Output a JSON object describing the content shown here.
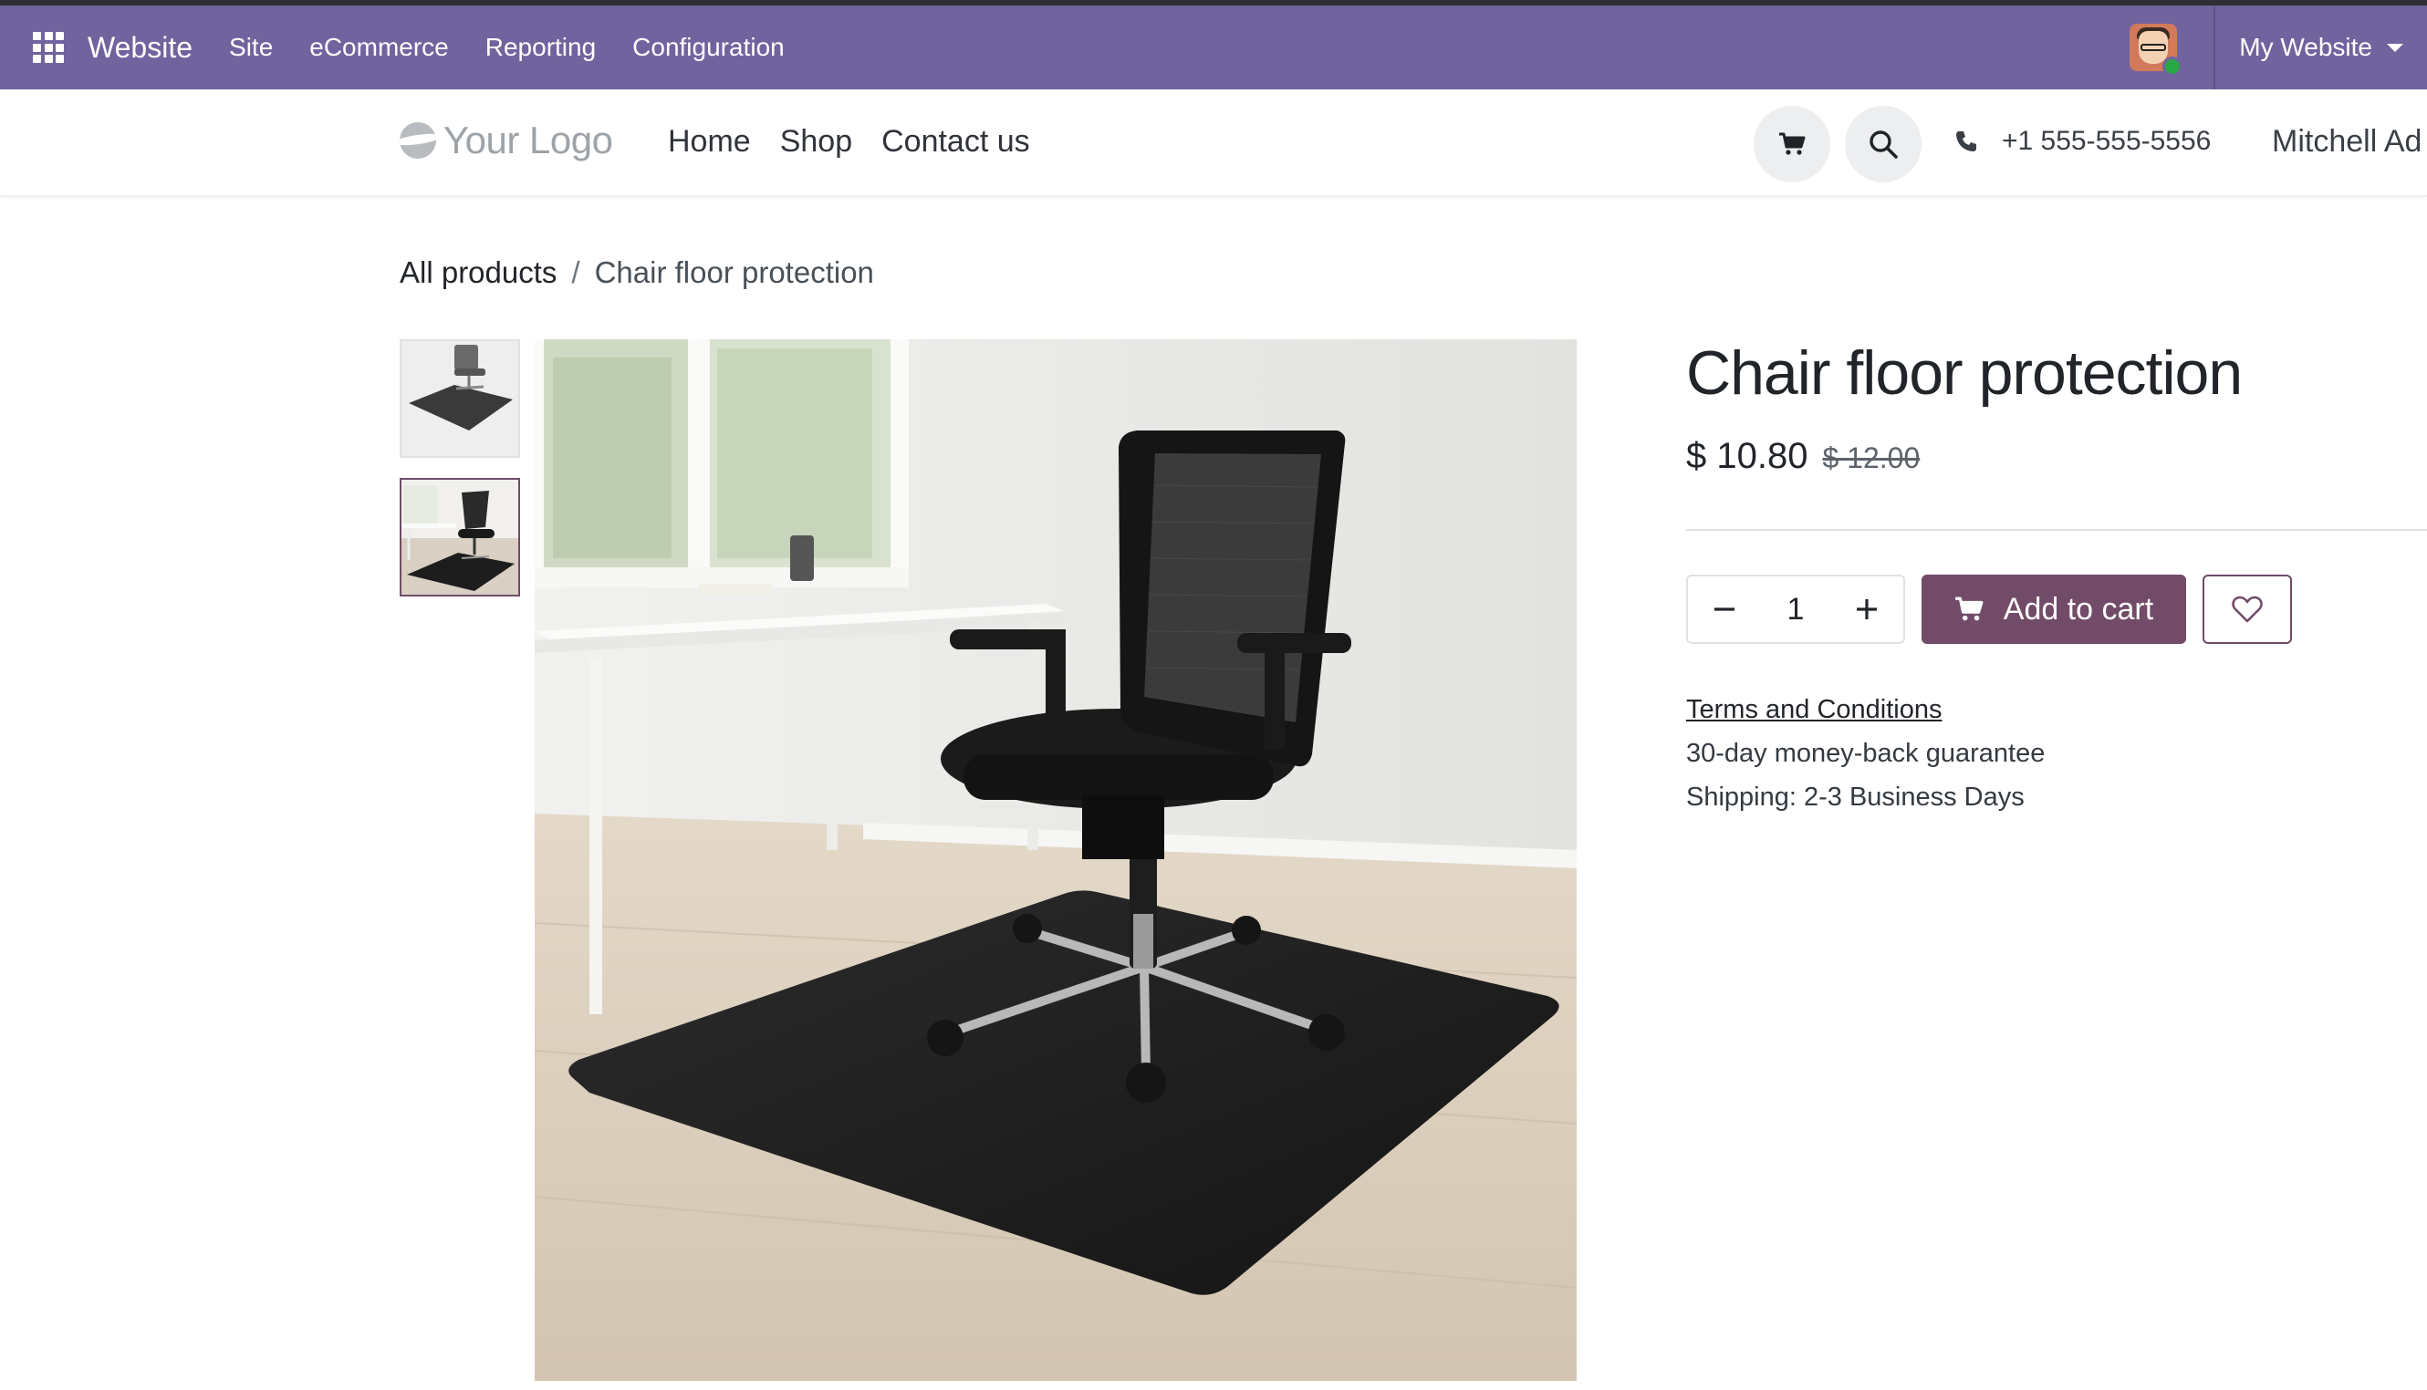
{
  "admin_bar": {
    "app_name": "Website",
    "menu": [
      "Site",
      "eCommerce",
      "Reporting",
      "Configuration"
    ],
    "website_selector": "My Website",
    "colors": {
      "background": "#71639e"
    }
  },
  "header": {
    "logo_text": "Your Logo",
    "nav": [
      "Home",
      "Shop",
      "Contact us"
    ],
    "phone": "+1 555-555-5556",
    "user_name": "Mitchell Ad",
    "icons": {
      "cart": "cart-icon",
      "search": "search-icon",
      "phone": "phone-icon"
    }
  },
  "breadcrumb": {
    "parent": "All products",
    "separator": "/",
    "current": "Chair floor protection"
  },
  "product": {
    "title": "Chair floor protection",
    "price": "$ 10.80",
    "old_price": "$ 12.00",
    "quantity": "1",
    "add_to_cart_label": "Add to cart",
    "terms_label": "Terms and Conditions",
    "guarantee": "30-day money-back guarantee",
    "shipping": "Shipping: 2-3 Business Days",
    "thumbnails": [
      "chair-mat-thumbnail",
      "office-chair-on-mat-thumbnail"
    ],
    "active_thumbnail": 2,
    "colors": {
      "primary": "#714b67"
    }
  }
}
